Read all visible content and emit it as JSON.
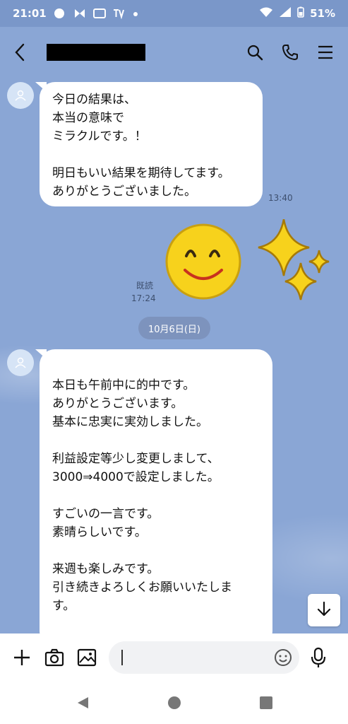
{
  "status_bar": {
    "time": "21:01",
    "battery": "51%",
    "icons": [
      "notification-icon",
      "tv-icon",
      "wifi-icon",
      "signal-icon",
      "battery-icon"
    ]
  },
  "header": {
    "icons": [
      "back-icon",
      "search-icon",
      "phone-icon",
      "menu-icon"
    ]
  },
  "messages": [
    {
      "paragraphs": [
        "今日の結果は、\n本当の意味で\nミラクルです。！",
        "明日もいい結果を期待してます。\nありがとうございました。"
      ],
      "time": "13:40"
    },
    {
      "sticker": "smiley-sparkle-sticker",
      "read_label": "既読",
      "time": "17:24"
    },
    {
      "paragraphs": [
        "本日も午前中に的中です。\nありがとうございます。\n基本に忠実に実効しました。",
        "利益設定等少し変更しまして、\n3000⇒4000で設定しました。",
        "すごいの一言です。\n素晴らしいです。",
        "来週も楽しみです。\n引き続きよろしくお願いいたしま\nす。"
      ]
    }
  ],
  "date_separator": "10月6日(日)",
  "colors": {
    "chat_background": "#8aa6d5",
    "status_bar": "#7a97c9",
    "bubble": "#ffffff",
    "date_chip": "#7d93bd"
  }
}
